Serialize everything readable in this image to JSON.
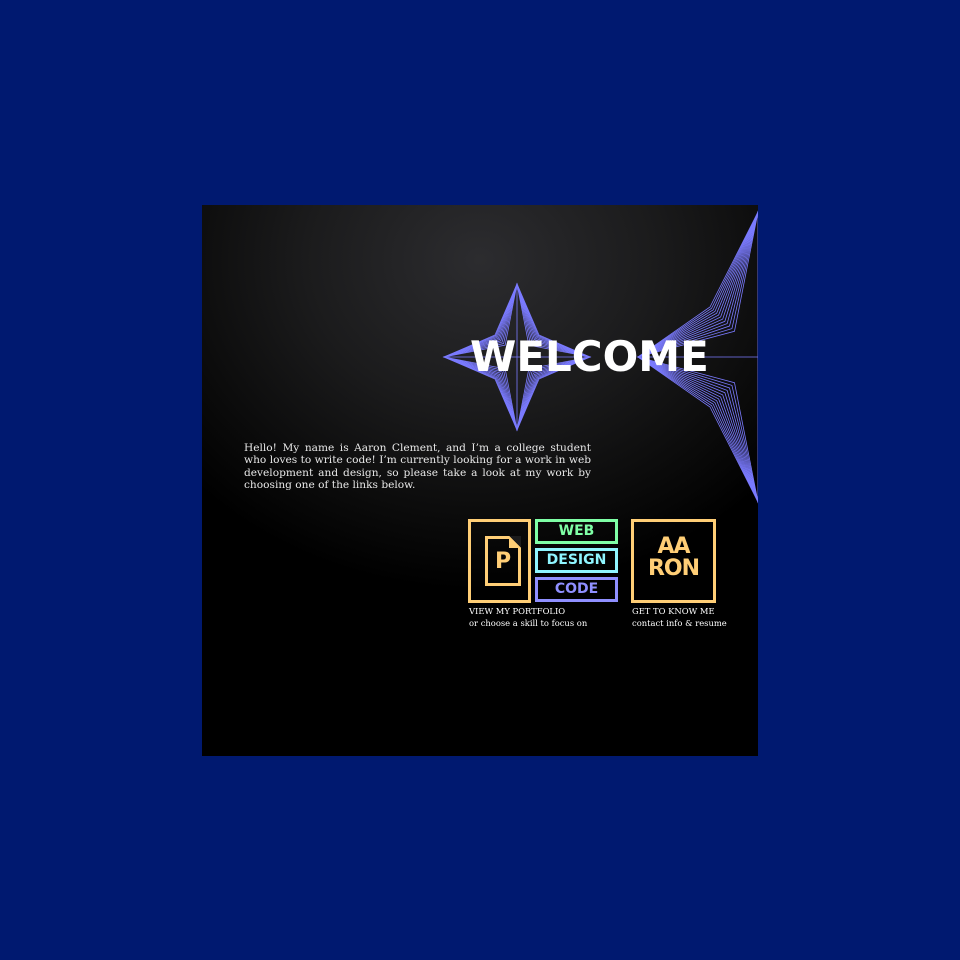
{
  "hero": {
    "title": "WELCOME",
    "intro": "Hello! My name is Aaron Clement, and I’m a college student who loves to write code! I’m currently looking for a work in web development and design, so please take a look at my work by choosing  one of the links below."
  },
  "links": {
    "portfolio": {
      "icon_letter": "P",
      "label": "VIEW MY PORTFOLIO",
      "sublabel": "or choose a skill to focus on"
    },
    "skills": [
      "WEB",
      "DESIGN",
      "CODE"
    ],
    "about": {
      "logo_line1": "AA",
      "logo_line2": "RON",
      "label": "GET TO KNOW ME",
      "sublabel": "contact info & resume"
    }
  },
  "colors": {
    "page_background": "#001970",
    "accent_gold": "#ffce76",
    "accent_green": "#7fffa6",
    "accent_cyan": "#8ff5ff",
    "accent_violet": "#8f8fff",
    "star_lines": "#7b7bff"
  }
}
